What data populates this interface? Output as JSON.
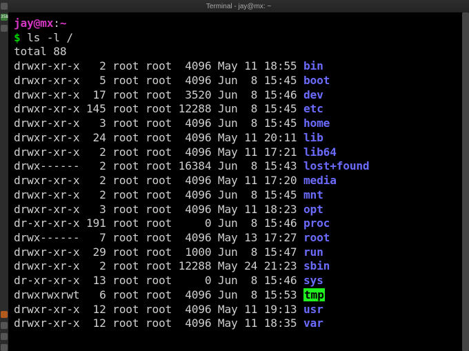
{
  "titlebar": {
    "label": "Terminal - jay@mx: ~"
  },
  "prompt": {
    "user": "jay",
    "at": "@",
    "host": "mx",
    "sep": ":",
    "cwd": "~",
    "symbol": "$",
    "command": "ls -l /"
  },
  "total_line": "total 88",
  "entries": [
    {
      "perm": "drwxr-xr-x",
      "links": "2",
      "owner": "root",
      "group": "root",
      "size": "4096",
      "month": "May",
      "day": "11",
      "time": "18:55",
      "name": "bin",
      "style": "dir"
    },
    {
      "perm": "drwxr-xr-x",
      "links": "5",
      "owner": "root",
      "group": "root",
      "size": "4096",
      "month": "Jun",
      "day": "8",
      "time": "15:45",
      "name": "boot",
      "style": "dir"
    },
    {
      "perm": "drwxr-xr-x",
      "links": "17",
      "owner": "root",
      "group": "root",
      "size": "3520",
      "month": "Jun",
      "day": "8",
      "time": "15:46",
      "name": "dev",
      "style": "dir"
    },
    {
      "perm": "drwxr-xr-x",
      "links": "145",
      "owner": "root",
      "group": "root",
      "size": "12288",
      "month": "Jun",
      "day": "8",
      "time": "15:45",
      "name": "etc",
      "style": "dir"
    },
    {
      "perm": "drwxr-xr-x",
      "links": "3",
      "owner": "root",
      "group": "root",
      "size": "4096",
      "month": "Jun",
      "day": "8",
      "time": "15:45",
      "name": "home",
      "style": "dir"
    },
    {
      "perm": "drwxr-xr-x",
      "links": "24",
      "owner": "root",
      "group": "root",
      "size": "4096",
      "month": "May",
      "day": "11",
      "time": "20:11",
      "name": "lib",
      "style": "dir"
    },
    {
      "perm": "drwxr-xr-x",
      "links": "2",
      "owner": "root",
      "group": "root",
      "size": "4096",
      "month": "May",
      "day": "11",
      "time": "17:21",
      "name": "lib64",
      "style": "dir"
    },
    {
      "perm": "drwx------",
      "links": "2",
      "owner": "root",
      "group": "root",
      "size": "16384",
      "month": "Jun",
      "day": "8",
      "time": "15:43",
      "name": "lost+found",
      "style": "dir"
    },
    {
      "perm": "drwxr-xr-x",
      "links": "2",
      "owner": "root",
      "group": "root",
      "size": "4096",
      "month": "May",
      "day": "11",
      "time": "17:20",
      "name": "media",
      "style": "dir"
    },
    {
      "perm": "drwxr-xr-x",
      "links": "2",
      "owner": "root",
      "group": "root",
      "size": "4096",
      "month": "Jun",
      "day": "8",
      "time": "15:45",
      "name": "mnt",
      "style": "dir"
    },
    {
      "perm": "drwxr-xr-x",
      "links": "3",
      "owner": "root",
      "group": "root",
      "size": "4096",
      "month": "May",
      "day": "11",
      "time": "18:23",
      "name": "opt",
      "style": "dir"
    },
    {
      "perm": "dr-xr-xr-x",
      "links": "191",
      "owner": "root",
      "group": "root",
      "size": "0",
      "month": "Jun",
      "day": "8",
      "time": "15:46",
      "name": "proc",
      "style": "dir"
    },
    {
      "perm": "drwx------",
      "links": "7",
      "owner": "root",
      "group": "root",
      "size": "4096",
      "month": "May",
      "day": "13",
      "time": "17:27",
      "name": "root",
      "style": "dir"
    },
    {
      "perm": "drwxr-xr-x",
      "links": "29",
      "owner": "root",
      "group": "root",
      "size": "1000",
      "month": "Jun",
      "day": "8",
      "time": "15:47",
      "name": "run",
      "style": "dir"
    },
    {
      "perm": "drwxr-xr-x",
      "links": "2",
      "owner": "root",
      "group": "root",
      "size": "12288",
      "month": "May",
      "day": "24",
      "time": "21:23",
      "name": "sbin",
      "style": "dir"
    },
    {
      "perm": "dr-xr-xr-x",
      "links": "13",
      "owner": "root",
      "group": "root",
      "size": "0",
      "month": "Jun",
      "day": "8",
      "time": "15:46",
      "name": "sys",
      "style": "dir"
    },
    {
      "perm": "drwxrwxrwt",
      "links": "6",
      "owner": "root",
      "group": "root",
      "size": "4096",
      "month": "Jun",
      "day": "8",
      "time": "15:53",
      "name": "tmp",
      "style": "sticky"
    },
    {
      "perm": "drwxr-xr-x",
      "links": "12",
      "owner": "root",
      "group": "root",
      "size": "4096",
      "month": "May",
      "day": "11",
      "time": "19:13",
      "name": "usr",
      "style": "dir"
    },
    {
      "perm": "drwxr-xr-x",
      "links": "12",
      "owner": "root",
      "group": "root",
      "size": "4096",
      "month": "May",
      "day": "11",
      "time": "18:35",
      "name": "var",
      "style": "dir"
    }
  ],
  "taskbar": {
    "badge": "358"
  }
}
